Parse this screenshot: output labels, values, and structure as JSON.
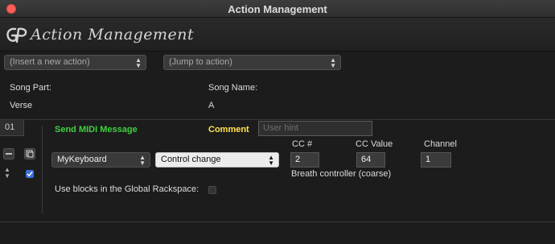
{
  "window": {
    "title": "Action Management"
  },
  "header": {
    "app_title": "Action Management"
  },
  "selectors": {
    "insert_action": "(Insert a new action)",
    "jump_to_action": "(Jump to action)"
  },
  "song_info": {
    "song_part_label": "Song Part:",
    "song_part_value": "Verse",
    "song_name_label": "Song Name:",
    "song_name_value": "A"
  },
  "action": {
    "number": "01",
    "type_label": "Send MIDI Message",
    "comment_label": "Comment",
    "comment_placeholder": "User hint",
    "device": "MyKeyboard",
    "message_type": "Control change",
    "cc_label": "CC #",
    "cc_value_label": "CC Value",
    "channel_label": "Channel",
    "cc_number": "2",
    "cc_value": "64",
    "channel": "1",
    "cc_description": "Breath controller (coarse)",
    "global_rackspace_label": "Use blocks in the Global Rackspace:",
    "enabled_checked": true,
    "global_rackspace_checked": false
  }
}
